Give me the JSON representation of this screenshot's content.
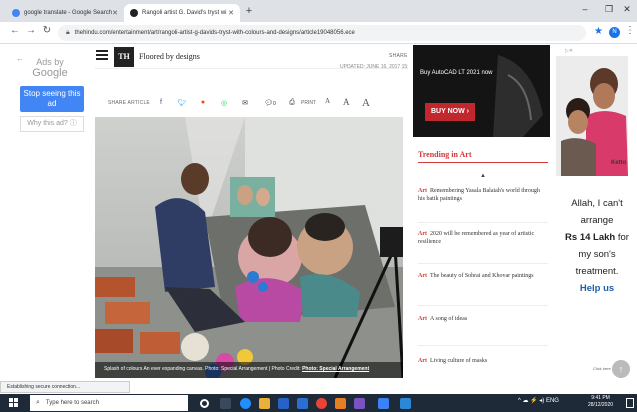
{
  "browser": {
    "tabs": [
      {
        "label": "google translate - Google Search",
        "active": false
      },
      {
        "label": "Rangoli artist G. David's tryst wi",
        "active": true
      }
    ],
    "new_tab": "+",
    "window_controls": {
      "minimize": "–",
      "restore": "❐",
      "close": "✕"
    },
    "url": "thehindu.com/entertainment/art/rangoli-artist-g-davids-tryst-with-colours-and-designs/article19048056.ece",
    "status_text": "Establishing secure connection..."
  },
  "left_ad": {
    "ads_by": "Ads by",
    "google": "Google",
    "stop_label": "Stop seeing this ad",
    "why_label": "Why this ad? ⓘ"
  },
  "site_header": {
    "logo": "TH",
    "headline": "Floored by designs",
    "share_on": "SHARE ON",
    "updated": "UPDATED: JUNE 16, 2017 15:49 IST"
  },
  "share_bar": {
    "share_article": "SHARE ARTICLE",
    "comment_count": "0",
    "print_label": "PRINT",
    "font_sizes": [
      "A",
      "A",
      "A"
    ]
  },
  "photo": {
    "caption_text": "Splash of colours An ever expanding canvas. Photo: Special Arrangement",
    "credit_prefix": "| Photo Credit:",
    "credit": "Photo: Special Arrangement"
  },
  "right_col": {
    "ad_text": "Buy AutoCAD LT 2021 now",
    "buy_now": "BUY NOW ›",
    "trending_title": "Trending in Art",
    "trending": [
      {
        "cat": "Art",
        "title": "Remembering Yasala Balaiah's world through his batik paintings"
      },
      {
        "cat": "Art",
        "title": "2020 will be remembered as year of artistic resilience"
      },
      {
        "cat": "Art",
        "title": "The beauty of Sohrai and Khovar paintings"
      },
      {
        "cat": "Art",
        "title": "A song of ideas"
      },
      {
        "cat": "Art",
        "title": "Living culture of masks"
      }
    ]
  },
  "ketto_ad": {
    "brand": "Ketto",
    "line1": "Allah, I can't",
    "line2": "arrange",
    "line3": "Rs 14 Lakh",
    "line3b": " for",
    "line4": "my son's",
    "line5": "treatment.",
    "line6": "Help us",
    "footer": "Click here now"
  },
  "taskbar": {
    "search_placeholder": "Type here to search",
    "tray_lang": "ENG",
    "time": "9:41 PM",
    "date": "28/12/2020"
  },
  "colors": {
    "accent_red": "#d23a3a",
    "google_blue": "#4285f4",
    "buy_red": "#c0282d",
    "taskbar": "#1f2a38"
  }
}
